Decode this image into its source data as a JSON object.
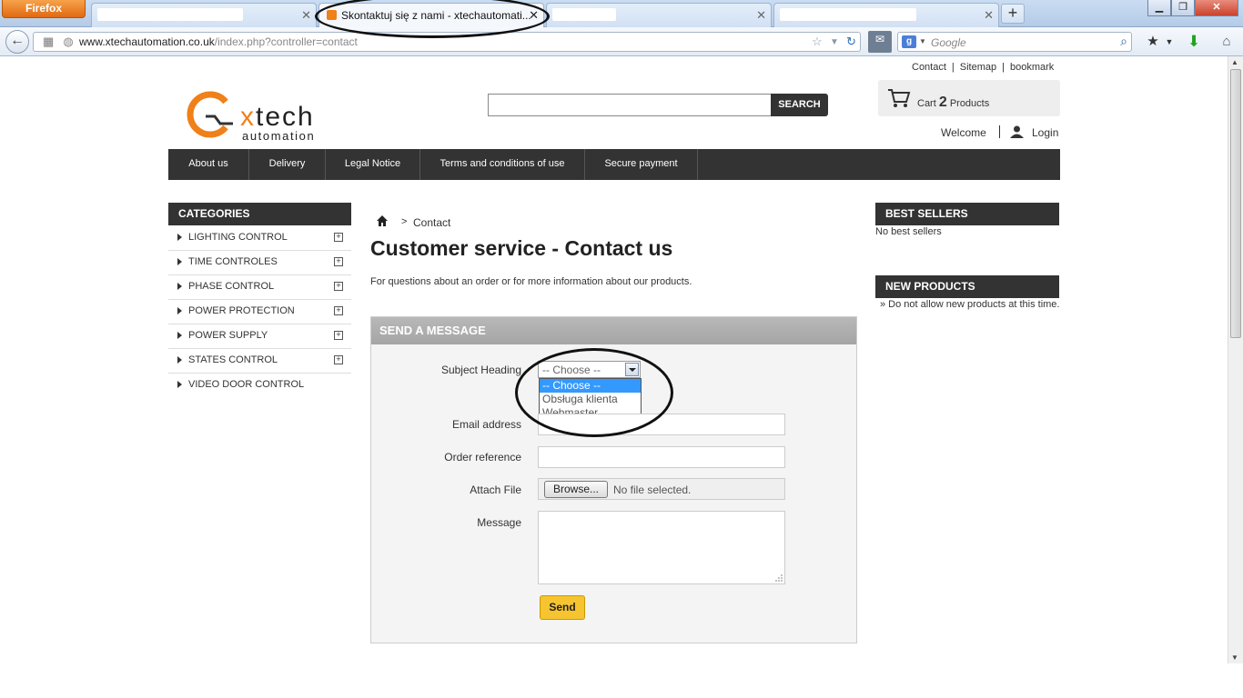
{
  "browser": {
    "app_button": "Firefox",
    "tabs": [
      {
        "title": "",
        "active": false
      },
      {
        "title": "Skontaktuj się z nami - xtechautomati...",
        "active": true
      },
      {
        "title": "",
        "active": false
      },
      {
        "title": "",
        "active": false
      }
    ],
    "url_host": "www.xtechautomation.co.uk",
    "url_path": "/index.php?controller=contact",
    "search_placeholder": "Google",
    "search_engine_letter": "g"
  },
  "header": {
    "links": [
      "Contact",
      "Sitemap",
      "bookmark"
    ],
    "logo": {
      "x_letter": "x",
      "word": "tech",
      "sub": "automation"
    },
    "search_button": "SEARCH",
    "cart_label": "Cart",
    "cart_count": "2",
    "cart_suffix": "Products",
    "welcome": "Welcome",
    "login": "Login"
  },
  "menu": [
    "About us",
    "Delivery",
    "Legal Notice",
    "Terms and conditions of use",
    "Secure payment"
  ],
  "categories": {
    "title": "CATEGORIES",
    "items": [
      {
        "label": "LIGHTING CONTROL",
        "expandable": true
      },
      {
        "label": "TIME CONTROLES",
        "expandable": true
      },
      {
        "label": "PHASE CONTROL",
        "expandable": true
      },
      {
        "label": "POWER PROTECTION",
        "expandable": true
      },
      {
        "label": "POWER SUPPLY",
        "expandable": true
      },
      {
        "label": "STATES CONTROL",
        "expandable": true
      },
      {
        "label": "VIDEO DOOR CONTROL",
        "expandable": false
      }
    ]
  },
  "breadcrumb": {
    "separator": ">",
    "current": "Contact"
  },
  "main": {
    "heading": "Customer service - Contact us",
    "intro": "For questions about an order or for more information about our products.",
    "form": {
      "title": "SEND A MESSAGE",
      "subject_label": "Subject Heading",
      "subject_value": "-- Choose --",
      "subject_options": [
        "-- Choose --",
        "Obsługa klienta",
        "Webmaster"
      ],
      "email_label": "Email address",
      "order_label": "Order reference",
      "file_label": "Attach File",
      "browse_button": "Browse...",
      "no_file": "No file selected.",
      "message_label": "Message",
      "send_button": "Send"
    }
  },
  "sidebar_right": {
    "best_sellers_title": "BEST SELLERS",
    "best_sellers_empty": "No best sellers",
    "new_products_title": "NEW PRODUCTS",
    "new_products_empty": "» Do not allow new products at this time."
  },
  "colors": {
    "accent_orange": "#f08019",
    "menu_bg": "#333333",
    "send_button": "#f5c430",
    "selected_option": "#3399ff"
  }
}
